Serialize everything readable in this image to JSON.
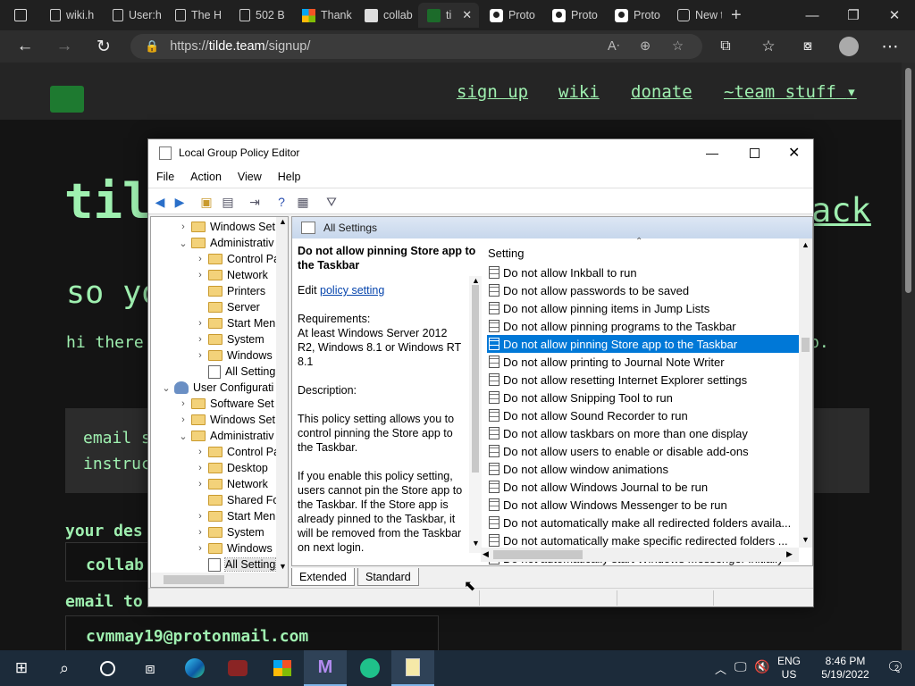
{
  "browser": {
    "tabs": [
      {
        "label": "wiki.h",
        "icon": "page-icon"
      },
      {
        "label": "User:h",
        "icon": "page-icon"
      },
      {
        "label": "The H",
        "icon": "page-icon"
      },
      {
        "label": "502 B",
        "icon": "page-icon"
      },
      {
        "label": "Thank",
        "icon": "microsoft-icon"
      },
      {
        "label": "collab",
        "icon": "collab-icon"
      },
      {
        "label": "ti",
        "icon": "tilde-icon"
      },
      {
        "label": "Proto",
        "icon": "person-icon"
      },
      {
        "label": "Proto",
        "icon": "person-icon"
      },
      {
        "label": "Proto",
        "icon": "person-icon"
      },
      {
        "label": "New t",
        "icon": "newtab-icon"
      }
    ],
    "url_prefix": "https://",
    "url_host": "tilde.team",
    "url_path": "/signup/"
  },
  "site": {
    "nav": [
      "sign up",
      "wiki",
      "donate",
      "~team stuff"
    ],
    "hero_left": "til",
    "hero_right": "ack",
    "subtitle": "so yo",
    "intro_left": "hi there",
    "intro_right": "p.",
    "email_box_line1": "email s",
    "email_box_line2": "instruc",
    "desired_label": "your des",
    "desired_value": "collab",
    "email_to_label": "email to",
    "email_value": "cvmmay19@protonmail.com"
  },
  "gpedit": {
    "title": "Local Group Policy Editor",
    "menu": [
      "File",
      "Action",
      "View",
      "Help"
    ],
    "tree": [
      {
        "label": "Windows Set",
        "level": 1,
        "arrow": "›",
        "icon": "folder"
      },
      {
        "label": "Administrativ",
        "level": 1,
        "arrow": "⌄",
        "icon": "folder"
      },
      {
        "label": "Control Pa",
        "level": 2,
        "arrow": "›",
        "icon": "folder"
      },
      {
        "label": "Network",
        "level": 2,
        "arrow": "›",
        "icon": "folder"
      },
      {
        "label": "Printers",
        "level": 2,
        "arrow": "",
        "icon": "folder"
      },
      {
        "label": "Server",
        "level": 2,
        "arrow": "",
        "icon": "folder"
      },
      {
        "label": "Start Men",
        "level": 2,
        "arrow": "›",
        "icon": "folder"
      },
      {
        "label": "System",
        "level": 2,
        "arrow": "›",
        "icon": "folder"
      },
      {
        "label": "Windows",
        "level": 2,
        "arrow": "›",
        "icon": "folder"
      },
      {
        "label": "All Setting",
        "level": 2,
        "arrow": "",
        "icon": "settings"
      },
      {
        "label": "User Configurati",
        "level": 0,
        "arrow": "⌄",
        "icon": "user"
      },
      {
        "label": "Software Set",
        "level": 1,
        "arrow": "›",
        "icon": "folder"
      },
      {
        "label": "Windows Set",
        "level": 1,
        "arrow": "›",
        "icon": "folder"
      },
      {
        "label": "Administrativ",
        "level": 1,
        "arrow": "⌄",
        "icon": "folder"
      },
      {
        "label": "Control Pa",
        "level": 2,
        "arrow": "›",
        "icon": "folder"
      },
      {
        "label": "Desktop",
        "level": 2,
        "arrow": "›",
        "icon": "folder"
      },
      {
        "label": "Network",
        "level": 2,
        "arrow": "›",
        "icon": "folder"
      },
      {
        "label": "Shared Fo",
        "level": 2,
        "arrow": "",
        "icon": "folder"
      },
      {
        "label": "Start Men",
        "level": 2,
        "arrow": "›",
        "icon": "folder"
      },
      {
        "label": "System",
        "level": 2,
        "arrow": "›",
        "icon": "folder"
      },
      {
        "label": "Windows",
        "level": 2,
        "arrow": "›",
        "icon": "folder"
      },
      {
        "label": "All Setting",
        "level": 2,
        "arrow": "",
        "icon": "settings",
        "selected": true
      }
    ],
    "pane_header": "All Settings",
    "desc_title": "Do not allow pinning Store app to the Taskbar",
    "desc_edit_prefix": "Edit ",
    "desc_edit_link": "policy setting",
    "desc_requirements_label": "Requirements:",
    "desc_requirements": "At least Windows Server 2012 R2, Windows 8.1 or Windows RT 8.1",
    "desc_description_label": "Description:",
    "desc_p1": "This policy setting allows you to control pinning the Store app to the Taskbar.",
    "desc_p2": "If you enable this policy setting, users cannot pin the Store app to the Taskbar. If the Store app is already pinned to the Taskbar, it will be removed from the Taskbar on next login.",
    "list_header": "Setting",
    "settings": [
      "Do not allow Inkball to run",
      "Do not allow passwords to be saved",
      "Do not allow pinning items in Jump Lists",
      "Do not allow pinning programs to the Taskbar",
      "Do not allow pinning Store app to the Taskbar",
      "Do not allow printing to Journal Note Writer",
      "Do not allow resetting Internet Explorer settings",
      "Do not allow Snipping Tool to run",
      "Do not allow Sound Recorder to run",
      "Do not allow taskbars on more than one display",
      "Do not allow users to enable or disable add-ons",
      "Do not allow window animations",
      "Do not allow Windows Journal to be run",
      "Do not allow Windows Messenger to be run",
      "Do not automatically make all redirected folders availa...",
      "Do not automatically make specific redirected folders ...",
      "Do not automatically start Windows Messenger initially"
    ],
    "selected_setting_index": 4,
    "tabs": [
      "Extended",
      "Standard"
    ]
  },
  "taskbar": {
    "lang_line1": "ENG",
    "lang_line2": "US",
    "time": "8:46 PM",
    "date": "5/19/2022",
    "notification_count": "2"
  },
  "colors": {
    "site_green": "#9ff0b0",
    "selection_blue": "#0078d7",
    "taskbar": "#1c2b3a"
  }
}
